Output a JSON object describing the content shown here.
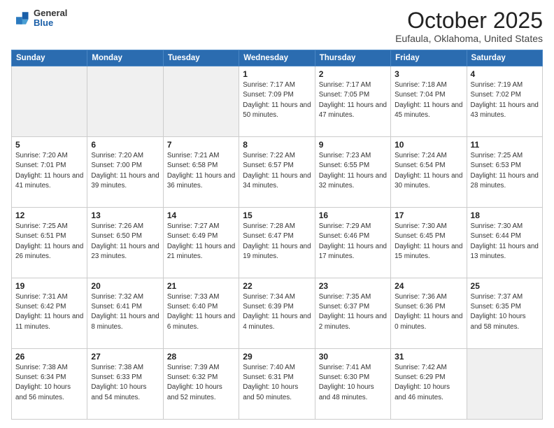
{
  "header": {
    "logo_general": "General",
    "logo_blue": "Blue",
    "month": "October 2025",
    "location": "Eufaula, Oklahoma, United States"
  },
  "days_of_week": [
    "Sunday",
    "Monday",
    "Tuesday",
    "Wednesday",
    "Thursday",
    "Friday",
    "Saturday"
  ],
  "weeks": [
    [
      {
        "day": "",
        "empty": true
      },
      {
        "day": "",
        "empty": true
      },
      {
        "day": "",
        "empty": true
      },
      {
        "day": "1",
        "sunrise": "7:17 AM",
        "sunset": "7:09 PM",
        "daylight": "11 hours and 50 minutes."
      },
      {
        "day": "2",
        "sunrise": "7:17 AM",
        "sunset": "7:05 PM",
        "daylight": "11 hours and 47 minutes."
      },
      {
        "day": "3",
        "sunrise": "7:18 AM",
        "sunset": "7:04 PM",
        "daylight": "11 hours and 45 minutes."
      },
      {
        "day": "4",
        "sunrise": "7:19 AM",
        "sunset": "7:02 PM",
        "daylight": "11 hours and 43 minutes."
      }
    ],
    [
      {
        "day": "5",
        "sunrise": "7:20 AM",
        "sunset": "7:01 PM",
        "daylight": "11 hours and 41 minutes."
      },
      {
        "day": "6",
        "sunrise": "7:20 AM",
        "sunset": "7:00 PM",
        "daylight": "11 hours and 39 minutes."
      },
      {
        "day": "7",
        "sunrise": "7:21 AM",
        "sunset": "6:58 PM",
        "daylight": "11 hours and 36 minutes."
      },
      {
        "day": "8",
        "sunrise": "7:22 AM",
        "sunset": "6:57 PM",
        "daylight": "11 hours and 34 minutes."
      },
      {
        "day": "9",
        "sunrise": "7:23 AM",
        "sunset": "6:55 PM",
        "daylight": "11 hours and 32 minutes."
      },
      {
        "day": "10",
        "sunrise": "7:24 AM",
        "sunset": "6:54 PM",
        "daylight": "11 hours and 30 minutes."
      },
      {
        "day": "11",
        "sunrise": "7:25 AM",
        "sunset": "6:53 PM",
        "daylight": "11 hours and 28 minutes."
      }
    ],
    [
      {
        "day": "12",
        "sunrise": "7:25 AM",
        "sunset": "6:51 PM",
        "daylight": "11 hours and 26 minutes."
      },
      {
        "day": "13",
        "sunrise": "7:26 AM",
        "sunset": "6:50 PM",
        "daylight": "11 hours and 23 minutes."
      },
      {
        "day": "14",
        "sunrise": "7:27 AM",
        "sunset": "6:49 PM",
        "daylight": "11 hours and 21 minutes."
      },
      {
        "day": "15",
        "sunrise": "7:28 AM",
        "sunset": "6:47 PM",
        "daylight": "11 hours and 19 minutes."
      },
      {
        "day": "16",
        "sunrise": "7:29 AM",
        "sunset": "6:46 PM",
        "daylight": "11 hours and 17 minutes."
      },
      {
        "day": "17",
        "sunrise": "7:30 AM",
        "sunset": "6:45 PM",
        "daylight": "11 hours and 15 minutes."
      },
      {
        "day": "18",
        "sunrise": "7:30 AM",
        "sunset": "6:44 PM",
        "daylight": "11 hours and 13 minutes."
      }
    ],
    [
      {
        "day": "19",
        "sunrise": "7:31 AM",
        "sunset": "6:42 PM",
        "daylight": "11 hours and 11 minutes."
      },
      {
        "day": "20",
        "sunrise": "7:32 AM",
        "sunset": "6:41 PM",
        "daylight": "11 hours and 8 minutes."
      },
      {
        "day": "21",
        "sunrise": "7:33 AM",
        "sunset": "6:40 PM",
        "daylight": "11 hours and 6 minutes."
      },
      {
        "day": "22",
        "sunrise": "7:34 AM",
        "sunset": "6:39 PM",
        "daylight": "11 hours and 4 minutes."
      },
      {
        "day": "23",
        "sunrise": "7:35 AM",
        "sunset": "6:37 PM",
        "daylight": "11 hours and 2 minutes."
      },
      {
        "day": "24",
        "sunrise": "7:36 AM",
        "sunset": "6:36 PM",
        "daylight": "11 hours and 0 minutes."
      },
      {
        "day": "25",
        "sunrise": "7:37 AM",
        "sunset": "6:35 PM",
        "daylight": "10 hours and 58 minutes."
      }
    ],
    [
      {
        "day": "26",
        "sunrise": "7:38 AM",
        "sunset": "6:34 PM",
        "daylight": "10 hours and 56 minutes."
      },
      {
        "day": "27",
        "sunrise": "7:38 AM",
        "sunset": "6:33 PM",
        "daylight": "10 hours and 54 minutes."
      },
      {
        "day": "28",
        "sunrise": "7:39 AM",
        "sunset": "6:32 PM",
        "daylight": "10 hours and 52 minutes."
      },
      {
        "day": "29",
        "sunrise": "7:40 AM",
        "sunset": "6:31 PM",
        "daylight": "10 hours and 50 minutes."
      },
      {
        "day": "30",
        "sunrise": "7:41 AM",
        "sunset": "6:30 PM",
        "daylight": "10 hours and 48 minutes."
      },
      {
        "day": "31",
        "sunrise": "7:42 AM",
        "sunset": "6:29 PM",
        "daylight": "10 hours and 46 minutes."
      },
      {
        "day": "",
        "empty": true
      }
    ]
  ],
  "labels": {
    "sunrise": "Sunrise:",
    "sunset": "Sunset:",
    "daylight": "Daylight:"
  }
}
